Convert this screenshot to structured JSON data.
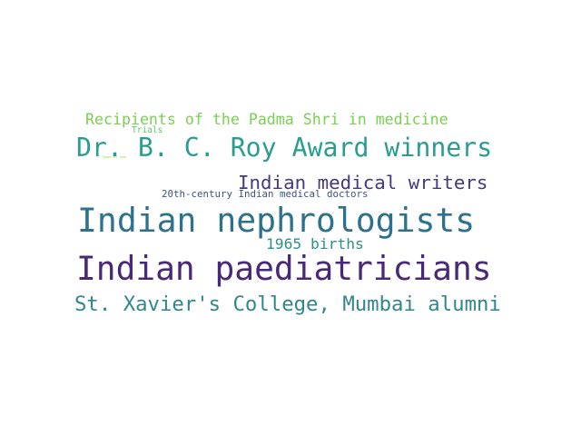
{
  "wordcloud": {
    "words": [
      {
        "text": "Recipients of the Padma Shri in medicine",
        "color": "#7ad151"
      },
      {
        "text": "Trials",
        "color": "#5ec962"
      },
      {
        "text": "Types of year",
        "color": "#95d840"
      },
      {
        "text": "Dr. B. C. Roy Award winners",
        "color": "#2a9d8f"
      },
      {
        "text": "Indian medical writers",
        "color": "#443983"
      },
      {
        "text": "20th-century Indian medical doctors",
        "color": "#3b528b"
      },
      {
        "text": "Indian nephrologists",
        "color": "#2c728e"
      },
      {
        "text": "1965 births",
        "color": "#2e8f8a"
      },
      {
        "text": "Indian paediatricians",
        "color": "#482878"
      },
      {
        "text": "St. Xavier's College, Mumbai alumni",
        "color": "#31868c"
      }
    ]
  }
}
